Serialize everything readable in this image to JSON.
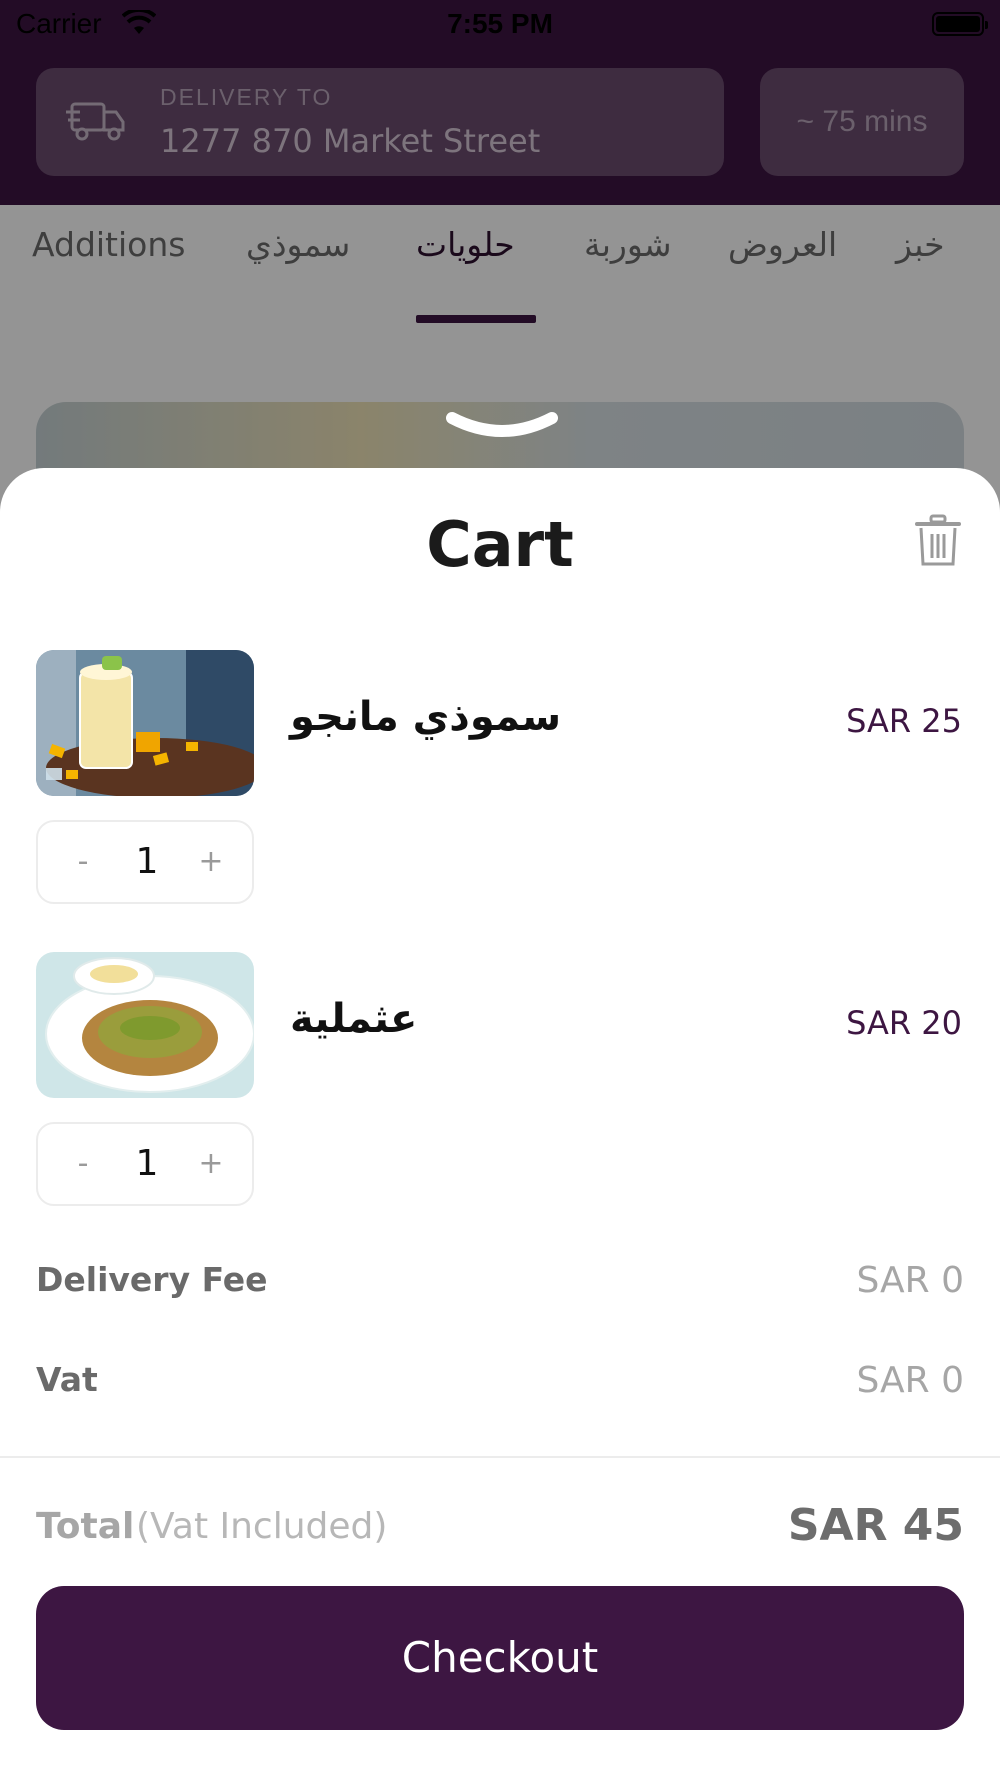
{
  "status_bar": {
    "carrier": "Carrier",
    "time": "7:55 PM",
    "icons": [
      "wifi-icon",
      "battery-icon"
    ]
  },
  "header": {
    "delivery_label": "DELIVERY TO",
    "delivery_address": "1277 870 Market Street",
    "eta": "~ 75 mins",
    "truck_icon": "truck-icon"
  },
  "tabs": [
    {
      "label": "Additions"
    },
    {
      "label": "سموذي"
    },
    {
      "label": "حلويات",
      "active": true
    },
    {
      "label": "شوربة"
    },
    {
      "label": "العروض"
    },
    {
      "label": "خبز"
    }
  ],
  "cart": {
    "title": "Cart",
    "trash_icon": "trash-icon",
    "items": [
      {
        "name": "سموذي مانجو",
        "price": "SAR 25",
        "quantity": "1",
        "minus": "-",
        "plus": "+",
        "image": "mango-smoothie-photo"
      },
      {
        "name": "عثملية",
        "price": "SAR 20",
        "quantity": "1",
        "minus": "-",
        "plus": "+",
        "image": "othmaliya-dessert-photo"
      }
    ],
    "fees": [
      {
        "label": "Delivery Fee",
        "value": "SAR 0"
      },
      {
        "label": "Vat",
        "value": "SAR 0"
      }
    ],
    "total": {
      "label": "Total",
      "note": "(Vat Included)",
      "value": "SAR 45"
    },
    "checkout_label": "Checkout"
  },
  "colors": {
    "brand": "#3d1642",
    "price": "#3d1642",
    "muted": "#a6a6a6"
  }
}
